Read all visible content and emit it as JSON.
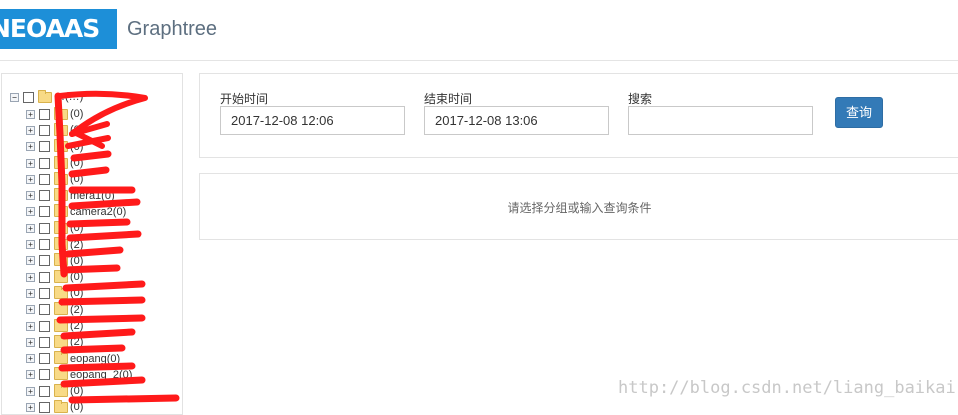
{
  "header": {
    "logo_text": "NEOAAS",
    "app_title": "Graphtree",
    "brand_color": "#1d8fd8"
  },
  "tree": {
    "root_label": "…(…)",
    "expand_icon": "plus-square-icon",
    "collapse_icon": "minus-square-icon",
    "folder_icon": "folder-icon",
    "items": [
      {
        "label": "(0)"
      },
      {
        "label": "(0)"
      },
      {
        "label": "(0)"
      },
      {
        "label": "(0)"
      },
      {
        "label": "(0)"
      },
      {
        "label": "mera1(0)"
      },
      {
        "label": "camera2(0)"
      },
      {
        "label": "(0)"
      },
      {
        "label": "(2)"
      },
      {
        "label": "(0)"
      },
      {
        "label": "(0)"
      },
      {
        "label": "(0)"
      },
      {
        "label": "(2)"
      },
      {
        "label": "(2)"
      },
      {
        "label": "(2)"
      },
      {
        "label": "eopang(0)"
      },
      {
        "label": "eopang_2(0)"
      },
      {
        "label": "(0)"
      },
      {
        "label": "(0)"
      }
    ]
  },
  "search": {
    "start_label": "开始时间",
    "start_value": "2017-12-08 12:06",
    "end_label": "结束时间",
    "end_value": "2017-12-08 13:06",
    "keyword_label": "搜索",
    "keyword_value": "",
    "query_button": "查询",
    "button_color": "#337ab7"
  },
  "result": {
    "message": "请选择分组或输入查询条件"
  },
  "watermark": "http://blog.csdn.net/liang_baikai"
}
